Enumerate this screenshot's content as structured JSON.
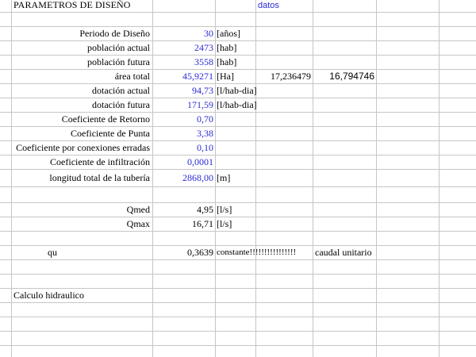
{
  "sheet": {
    "title": "PARAMETROS DE DISEÑO",
    "datos": "datos",
    "colors": {
      "value": "#2b2bd6",
      "grid": "#c6c6c6"
    },
    "params": [
      {
        "label": "Periodo de Diseño",
        "value": "30",
        "unit": "[años]"
      },
      {
        "label": "población actual",
        "value": "2473",
        "unit": "[hab]"
      },
      {
        "label": "población futura",
        "value": "3558",
        "unit": "[hab]"
      },
      {
        "label": "área total",
        "value": "45,9271",
        "unit": "[Ha]",
        "extra1": "17,236479",
        "extra2": "16,794746"
      },
      {
        "label": "dotación actual",
        "value": "94,73",
        "unit": "[l/hab-dia]"
      },
      {
        "label": "dotación futura",
        "value": "171,59",
        "unit": "[l/hab-dia]"
      },
      {
        "label": "Coeficiente de Retorno",
        "value": "0,70",
        "unit": ""
      },
      {
        "label": "Coeficiente de Punta",
        "value": "3,38",
        "unit": ""
      },
      {
        "label": "Coeficiente por conexiones erradas",
        "value": "0,10",
        "unit": ""
      },
      {
        "label": "Coeficiente de infiltración",
        "value": "0,0001",
        "unit": ""
      },
      {
        "label": "longitud total de la tubería",
        "value": "2868,00",
        "unit": "[m]"
      }
    ],
    "qmed": {
      "label": "Qmed",
      "value": "4,95",
      "unit": "[l/s]"
    },
    "qmax": {
      "label": "Qmax",
      "value": "16,71",
      "unit": "[l/s]"
    },
    "qu": {
      "label": "qu",
      "value": "0,3639",
      "note": "constante!!!!!!!!!!!!!!!!",
      "note2": "caudal unitario"
    },
    "calculo": "Calculo hidraulico"
  }
}
